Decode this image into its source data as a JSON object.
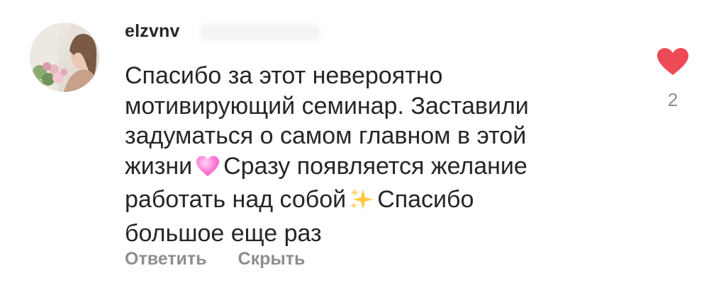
{
  "comment": {
    "username": "elzvnv",
    "text_lines": [
      "Спасибо за этот невероятно",
      "мотивирующий семинар. Заставили",
      "задуматься о самом главном в этой",
      "жизни",
      "Сразу появляется желание",
      "работать над собой",
      "Спасибо",
      "большое еще раз"
    ],
    "emojis": [
      "pink-heart",
      "sparkles"
    ],
    "actions": {
      "reply": "Ответить",
      "hide": "Скрыть"
    },
    "likes": {
      "count": "2",
      "liked": true,
      "color": "#ed4956"
    }
  }
}
